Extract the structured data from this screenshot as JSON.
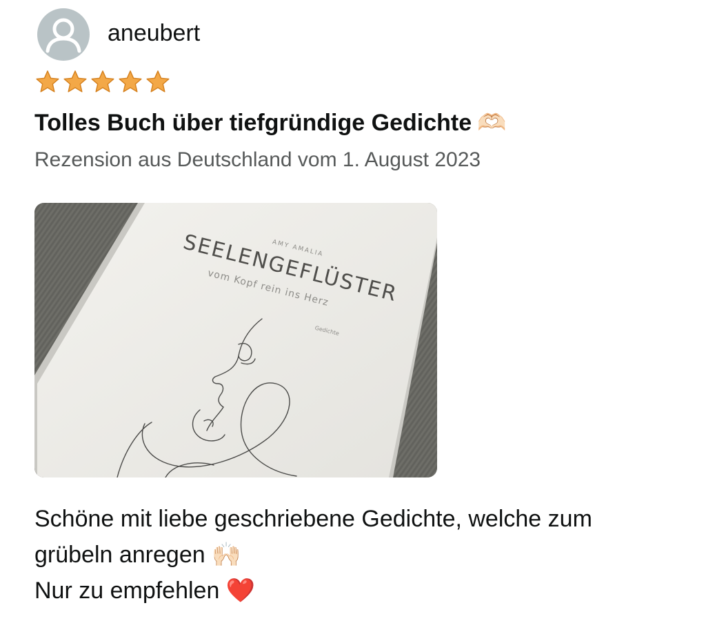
{
  "review": {
    "username": "aneubert",
    "avatar_icon": "user-silhouette-icon",
    "rating": 5,
    "rating_max": 5,
    "star_color": "#f3a847",
    "title": "Tolles Buch über tiefgründige Gedichte",
    "title_emoji": "🫶🏻",
    "meta": "Rezension aus Deutschland vom 1. August 2023",
    "photo": {
      "book_author": "AMY AMALIA",
      "book_title": "SEELENGEFLÜSTER",
      "book_subtitle": "vom Kopf rein ins Herz",
      "book_genre": "Gedichte"
    },
    "body_line1": "Schöne mit liebe geschriebene Gedichte, welche zum grübeln anregen",
    "body_emoji1": "🙌🏻",
    "body_line2": "Nur zu empfehlen",
    "body_emoji2": "❤️"
  }
}
